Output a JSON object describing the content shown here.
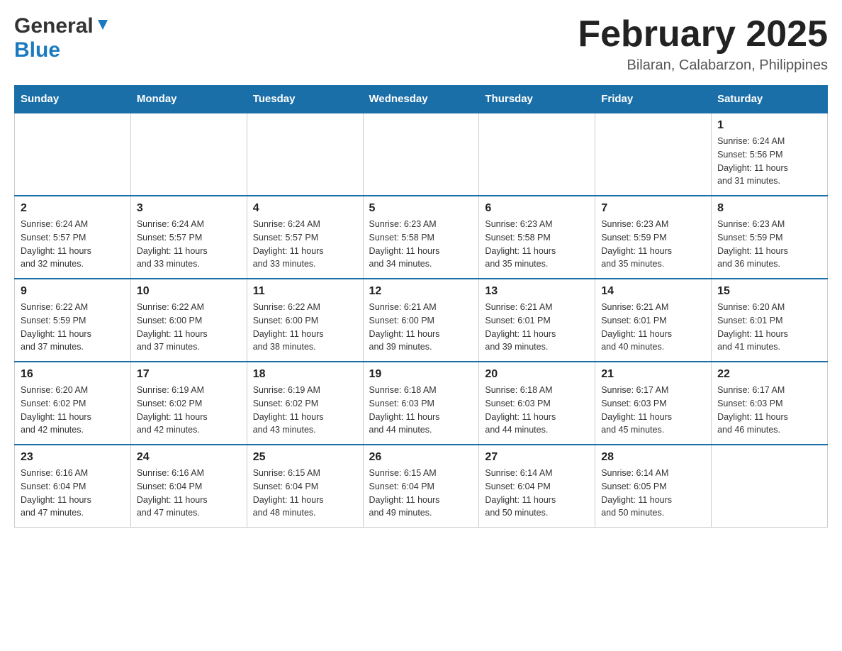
{
  "header": {
    "logo_general": "General",
    "logo_blue": "Blue",
    "month_title": "February 2025",
    "location": "Bilaran, Calabarzon, Philippines"
  },
  "weekdays": [
    "Sunday",
    "Monday",
    "Tuesday",
    "Wednesday",
    "Thursday",
    "Friday",
    "Saturday"
  ],
  "weeks": [
    {
      "days": [
        {
          "number": "",
          "info": ""
        },
        {
          "number": "",
          "info": ""
        },
        {
          "number": "",
          "info": ""
        },
        {
          "number": "",
          "info": ""
        },
        {
          "number": "",
          "info": ""
        },
        {
          "number": "",
          "info": ""
        },
        {
          "number": "1",
          "info": "Sunrise: 6:24 AM\nSunset: 5:56 PM\nDaylight: 11 hours\nand 31 minutes."
        }
      ]
    },
    {
      "days": [
        {
          "number": "2",
          "info": "Sunrise: 6:24 AM\nSunset: 5:57 PM\nDaylight: 11 hours\nand 32 minutes."
        },
        {
          "number": "3",
          "info": "Sunrise: 6:24 AM\nSunset: 5:57 PM\nDaylight: 11 hours\nand 33 minutes."
        },
        {
          "number": "4",
          "info": "Sunrise: 6:24 AM\nSunset: 5:57 PM\nDaylight: 11 hours\nand 33 minutes."
        },
        {
          "number": "5",
          "info": "Sunrise: 6:23 AM\nSunset: 5:58 PM\nDaylight: 11 hours\nand 34 minutes."
        },
        {
          "number": "6",
          "info": "Sunrise: 6:23 AM\nSunset: 5:58 PM\nDaylight: 11 hours\nand 35 minutes."
        },
        {
          "number": "7",
          "info": "Sunrise: 6:23 AM\nSunset: 5:59 PM\nDaylight: 11 hours\nand 35 minutes."
        },
        {
          "number": "8",
          "info": "Sunrise: 6:23 AM\nSunset: 5:59 PM\nDaylight: 11 hours\nand 36 minutes."
        }
      ]
    },
    {
      "days": [
        {
          "number": "9",
          "info": "Sunrise: 6:22 AM\nSunset: 5:59 PM\nDaylight: 11 hours\nand 37 minutes."
        },
        {
          "number": "10",
          "info": "Sunrise: 6:22 AM\nSunset: 6:00 PM\nDaylight: 11 hours\nand 37 minutes."
        },
        {
          "number": "11",
          "info": "Sunrise: 6:22 AM\nSunset: 6:00 PM\nDaylight: 11 hours\nand 38 minutes."
        },
        {
          "number": "12",
          "info": "Sunrise: 6:21 AM\nSunset: 6:00 PM\nDaylight: 11 hours\nand 39 minutes."
        },
        {
          "number": "13",
          "info": "Sunrise: 6:21 AM\nSunset: 6:01 PM\nDaylight: 11 hours\nand 39 minutes."
        },
        {
          "number": "14",
          "info": "Sunrise: 6:21 AM\nSunset: 6:01 PM\nDaylight: 11 hours\nand 40 minutes."
        },
        {
          "number": "15",
          "info": "Sunrise: 6:20 AM\nSunset: 6:01 PM\nDaylight: 11 hours\nand 41 minutes."
        }
      ]
    },
    {
      "days": [
        {
          "number": "16",
          "info": "Sunrise: 6:20 AM\nSunset: 6:02 PM\nDaylight: 11 hours\nand 42 minutes."
        },
        {
          "number": "17",
          "info": "Sunrise: 6:19 AM\nSunset: 6:02 PM\nDaylight: 11 hours\nand 42 minutes."
        },
        {
          "number": "18",
          "info": "Sunrise: 6:19 AM\nSunset: 6:02 PM\nDaylight: 11 hours\nand 43 minutes."
        },
        {
          "number": "19",
          "info": "Sunrise: 6:18 AM\nSunset: 6:03 PM\nDaylight: 11 hours\nand 44 minutes."
        },
        {
          "number": "20",
          "info": "Sunrise: 6:18 AM\nSunset: 6:03 PM\nDaylight: 11 hours\nand 44 minutes."
        },
        {
          "number": "21",
          "info": "Sunrise: 6:17 AM\nSunset: 6:03 PM\nDaylight: 11 hours\nand 45 minutes."
        },
        {
          "number": "22",
          "info": "Sunrise: 6:17 AM\nSunset: 6:03 PM\nDaylight: 11 hours\nand 46 minutes."
        }
      ]
    },
    {
      "days": [
        {
          "number": "23",
          "info": "Sunrise: 6:16 AM\nSunset: 6:04 PM\nDaylight: 11 hours\nand 47 minutes."
        },
        {
          "number": "24",
          "info": "Sunrise: 6:16 AM\nSunset: 6:04 PM\nDaylight: 11 hours\nand 47 minutes."
        },
        {
          "number": "25",
          "info": "Sunrise: 6:15 AM\nSunset: 6:04 PM\nDaylight: 11 hours\nand 48 minutes."
        },
        {
          "number": "26",
          "info": "Sunrise: 6:15 AM\nSunset: 6:04 PM\nDaylight: 11 hours\nand 49 minutes."
        },
        {
          "number": "27",
          "info": "Sunrise: 6:14 AM\nSunset: 6:04 PM\nDaylight: 11 hours\nand 50 minutes."
        },
        {
          "number": "28",
          "info": "Sunrise: 6:14 AM\nSunset: 6:05 PM\nDaylight: 11 hours\nand 50 minutes."
        },
        {
          "number": "",
          "info": ""
        }
      ]
    }
  ]
}
